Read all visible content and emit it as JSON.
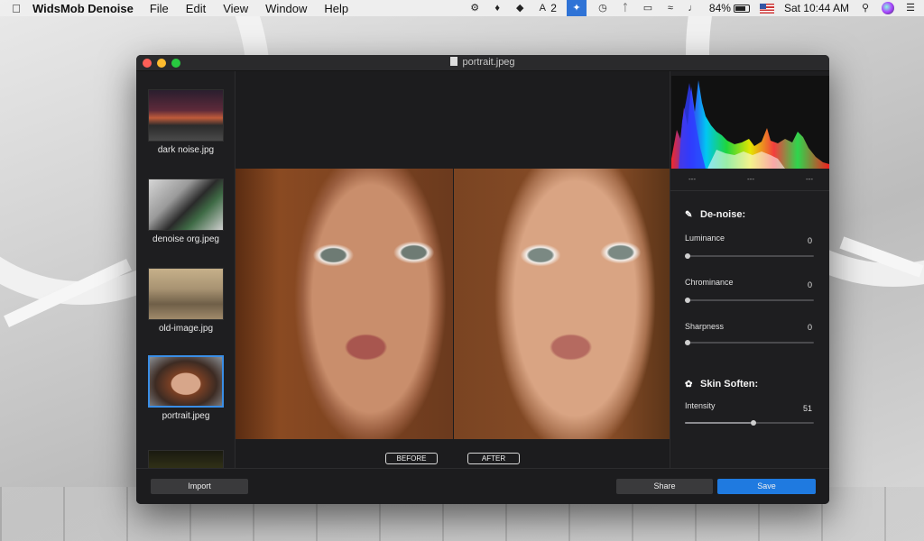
{
  "menubar": {
    "apple_icon": "apple-logo",
    "app_name": "WidsMob Denoise",
    "menus": [
      "File",
      "Edit",
      "View",
      "Window",
      "Help"
    ],
    "status": {
      "adobe_count": "2",
      "battery": "84%",
      "clock": "Sat 10:44 AM"
    }
  },
  "window": {
    "title": "portrait.jpeg"
  },
  "sidebar": {
    "items": [
      {
        "label": "dark noise.jpg"
      },
      {
        "label": "denoise org.jpeg"
      },
      {
        "label": "old-image.jpg"
      },
      {
        "label": "portrait.jpeg",
        "selected": true
      },
      {
        "label": ""
      }
    ]
  },
  "viewer": {
    "before_label": "BEFORE",
    "after_label": "AFTER"
  },
  "panel": {
    "histogram_readouts": [
      "---",
      "---",
      "---"
    ],
    "denoise": {
      "title": "De-noise:",
      "sliders": [
        {
          "label": "Luminance",
          "value": 0
        },
        {
          "label": "Chrominance",
          "value": 0
        },
        {
          "label": "Sharpness",
          "value": 0
        }
      ]
    },
    "skin": {
      "title": "Skin Soften:",
      "sliders": [
        {
          "label": "Intensity",
          "value": 51,
          "max": 100
        }
      ]
    }
  },
  "bottombar": {
    "import_label": "Import",
    "share_label": "Share",
    "save_label": "Save"
  },
  "colors": {
    "accent": "#1f7ae0",
    "selection": "#3a8ee6",
    "window_bg": "#1c1c1e"
  }
}
